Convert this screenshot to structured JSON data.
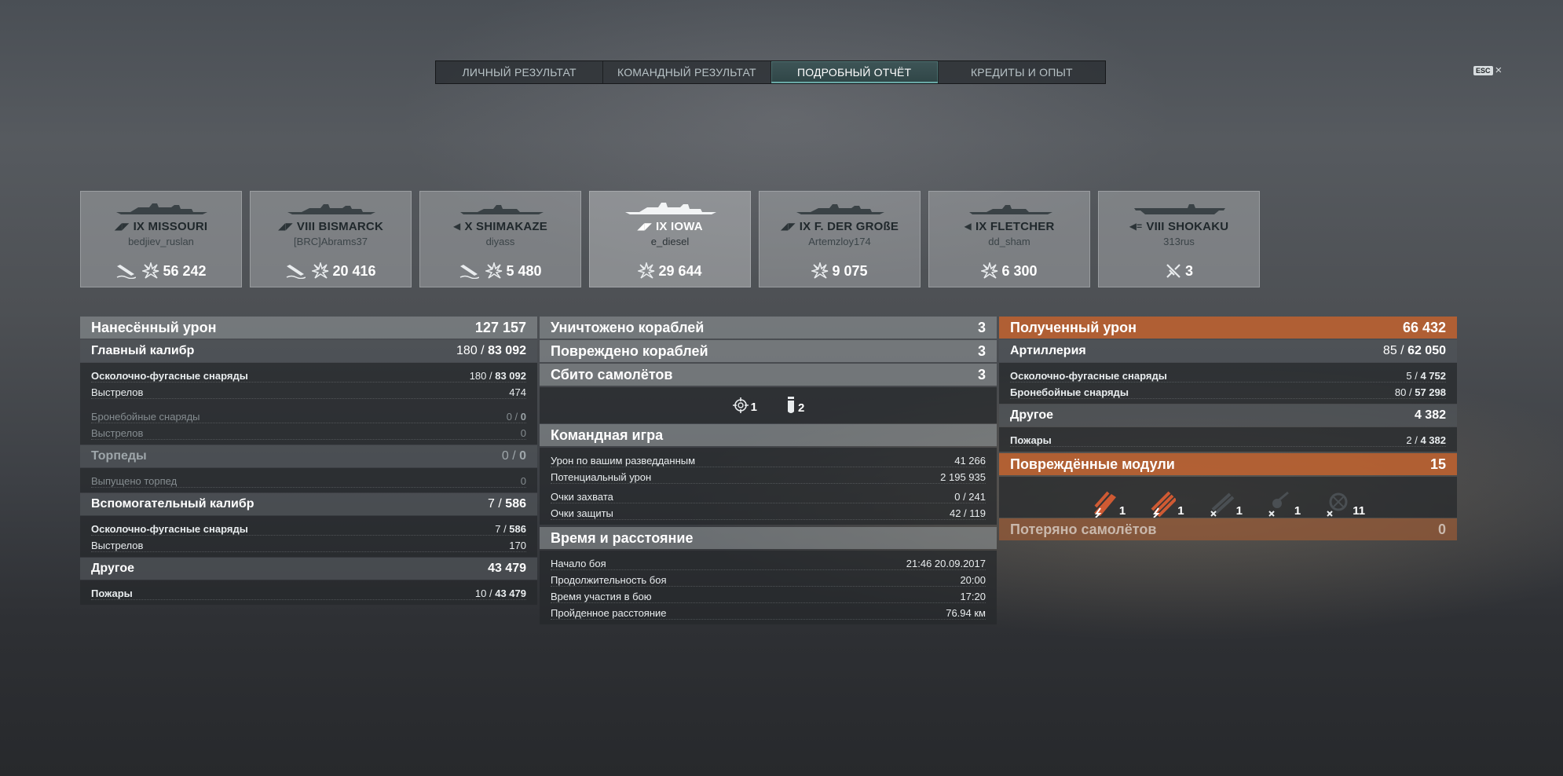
{
  "tabs": [
    {
      "label": "ЛИЧНЫЙ РЕЗУЛЬТАТ"
    },
    {
      "label": "КОМАНДНЫЙ РЕЗУЛЬТАТ"
    },
    {
      "label": "ПОДРОБНЫЙ ОТЧЁТ",
      "active": true
    },
    {
      "label": "КРЕДИТЫ И ОПЫТ"
    }
  ],
  "close": {
    "key": "ESC",
    "icon": "×"
  },
  "ships": [
    {
      "name": "IX MISSOURI",
      "player": "bedjiev_ruslan",
      "damage": "56 242"
    },
    {
      "name": "VIII BISMARCK",
      "player": "[BRC]Abrams37",
      "damage": "20 416"
    },
    {
      "name": "X SHIMAKAZE",
      "player": "diyass",
      "damage": "5 480"
    },
    {
      "name": "IX IOWA",
      "player": "e_diesel",
      "damage": "29 644"
    },
    {
      "name": "IX F. DER GROßE",
      "player": "Artemzloy174",
      "damage": "9 075"
    },
    {
      "name": "IX FLETCHER",
      "player": "dd_sham",
      "damage": "6 300"
    },
    {
      "name": "VIII SHOKAKU",
      "player": "313rus",
      "damage": "3"
    }
  ],
  "dealt": {
    "title": "Нанесённый урон",
    "total": "127 157",
    "main": {
      "title": "Главный калибр",
      "hits": "180",
      "dmg": "83 092"
    },
    "main_he": {
      "label": "Осколочно-фугасные снаряды",
      "hits": "180",
      "dmg": "83 092"
    },
    "main_he_shots": {
      "label": "Выстрелов",
      "value": "474"
    },
    "main_ap": {
      "label": "Бронебойные снаряды",
      "hits": "0",
      "dmg": "0"
    },
    "main_ap_shots": {
      "label": "Выстрелов",
      "value": "0"
    },
    "torp": {
      "title": "Торпеды",
      "hits": "0",
      "dmg": "0"
    },
    "torp_launched": {
      "label": "Выпущено торпед",
      "value": "0"
    },
    "sec": {
      "title": "Вспомогательный калибр",
      "hits": "7",
      "dmg": "586"
    },
    "sec_he": {
      "label": "Осколочно-фугасные снаряды",
      "hits": "7",
      "dmg": "586"
    },
    "sec_shots": {
      "label": "Выстрелов",
      "value": "170"
    },
    "other": {
      "title": "Другое",
      "value": "43 479"
    },
    "fires": {
      "label": "Пожары",
      "count": "10",
      "dmg": "43 479"
    }
  },
  "mid": {
    "destroyed": {
      "label": "Уничтожено кораблей",
      "value": "3"
    },
    "damaged": {
      "label": "Повреждено кораблей",
      "value": "3"
    },
    "planes": {
      "label": "Сбито самолётов",
      "value": "3"
    },
    "planes_icons": [
      {
        "icon": "crosshair-icon",
        "value": "1"
      },
      {
        "icon": "bomb-icon",
        "value": "2"
      }
    ],
    "team": {
      "title": "Командная игра"
    },
    "spotting": {
      "label": "Урон по вашим разведданным",
      "value": "41 266"
    },
    "potential": {
      "label": "Потенциальный урон",
      "value": "2 195 935"
    },
    "capture": {
      "label": "Очки захвата",
      "value": "0 / 241"
    },
    "defense": {
      "label": "Очки защиты",
      "value": "42 / 119"
    },
    "time": {
      "title": "Время и расстояние"
    },
    "start": {
      "label": "Начало боя",
      "value": "21:46  20.09.2017"
    },
    "duration": {
      "label": "Продолжительность боя",
      "value": "20:00"
    },
    "participation": {
      "label": "Время участия в бою",
      "value": "17:20"
    },
    "distance": {
      "label": "Пройденное расстояние",
      "value": "76.94 км"
    }
  },
  "received": {
    "title": "Полученный урон",
    "total": "66 432",
    "art": {
      "title": "Артиллерия",
      "hits": "85",
      "dmg": "62 050"
    },
    "he": {
      "label": "Осколочно-фугасные снаряды",
      "hits": "5",
      "dmg": "4 752"
    },
    "ap": {
      "label": "Бронебойные снаряды",
      "hits": "80",
      "dmg": "57 298"
    },
    "other": {
      "title": "Другое",
      "value": "4 382"
    },
    "fires": {
      "label": "Пожары",
      "count": "2",
      "dmg": "4 382"
    },
    "modules": {
      "title": "Повреждённые модули",
      "value": "15"
    },
    "module_icons": [
      {
        "icon": "main-battery-damaged-icon",
        "value": "1"
      },
      {
        "icon": "torpedo-tubes-damaged-icon",
        "value": "1"
      },
      {
        "icon": "secondary-battery-destroyed-icon",
        "value": "1"
      },
      {
        "icon": "aa-gun-destroyed-icon",
        "value": "1"
      },
      {
        "icon": "aa-mount-destroyed-icon",
        "value": "11"
      }
    ],
    "lost_planes": {
      "title": "Потеряно самолётов",
      "value": "0"
    }
  }
}
